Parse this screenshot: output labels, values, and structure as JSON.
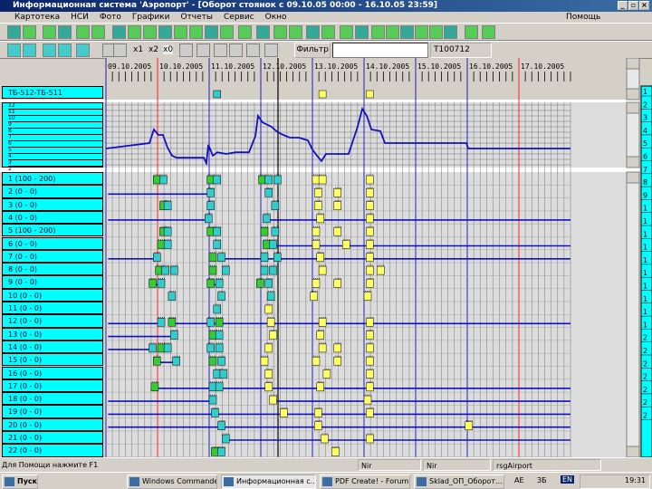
{
  "window": {
    "title": "Информационная система 'Аэропорт' - [Оборот стоянок с 09.10.05 00:00 - 16.10.05 23:59]"
  },
  "menu": {
    "items": [
      "Картотека",
      "НСИ",
      "Фото",
      "Графики",
      "Отчеты",
      "Сервис",
      "Окно"
    ],
    "help": "Помощь"
  },
  "toolbar2": {
    "zoom_x1": "x1",
    "zoom_x2": "x2",
    "zoom_x0": "x0",
    "filter_label": "Фильтр",
    "filter_value": "",
    "code_value": "T100712"
  },
  "timeline": {
    "dates": [
      "09.10.2005",
      "10.10.2005",
      "11.10.2005",
      "12.10.2005",
      "13.10.2005",
      "14.10.2005",
      "15.10.2005",
      "16.10.2005",
      "17.10.2005"
    ],
    "header_label": "ТБ-512-ТБ-511"
  },
  "graph": {
    "y_labels": [
      "12",
      "11",
      "10",
      "9",
      "8",
      "7",
      "6",
      "5",
      "4",
      "3",
      "2",
      "1"
    ],
    "series_hours": [
      0,
      20.2,
      22.3,
      24.4,
      26.5,
      28.6,
      30.7,
      32.8,
      45.5,
      46.7,
      47.6,
      49.7,
      51.8,
      56,
      60.2,
      66.5,
      69.5,
      70.7,
      72.8,
      77,
      79.2,
      81.3,
      85.5,
      89.7,
      93.9,
      96,
      98.1,
      100.2,
      102.3,
      112.8,
      117,
      119.2,
      121.3,
      123.4,
      127.6,
      129.7,
      167.6,
      168.4,
      216
    ],
    "series_levels": [
      3.5,
      4.5,
      7,
      6,
      6,
      3.7,
      2.2,
      1.8,
      1.8,
      0.8,
      4.2,
      2.2,
      2.8,
      2.5,
      2.8,
      2.8,
      5.8,
      9.5,
      8.3,
      7.5,
      6.7,
      6.2,
      5.5,
      5.5,
      5,
      3.3,
      2.2,
      1.2,
      2.5,
      2.5,
      7.5,
      10.8,
      9.5,
      7,
      6.7,
      4.5,
      4.5,
      3.5,
      3.5
    ]
  },
  "colors": {
    "cyan": "#00ffff",
    "green": "#33cc33",
    "marker_cyan": "#33cccc",
    "yellow": "#ffff66",
    "line": "#1010c0",
    "day": "#2020c0",
    "now": "#ff2020"
  },
  "rows": [
    {
      "label": "1 (100 - 200)",
      "lines": [],
      "m": [
        [
          22,
          "g"
        ],
        [
          25,
          "c"
        ],
        [
          47,
          "g"
        ],
        [
          50,
          "c"
        ],
        [
          71,
          "g"
        ],
        [
          74,
          "c"
        ],
        [
          78,
          "c"
        ],
        [
          96,
          "y"
        ],
        [
          99,
          "y"
        ],
        [
          121,
          "y"
        ]
      ]
    },
    {
      "label": "2 (0 - 0)",
      "lines": [
        [
          1,
          47
        ]
      ],
      "m": [
        [
          47,
          "c"
        ],
        [
          74,
          "c"
        ],
        [
          97,
          "y"
        ],
        [
          106,
          "y"
        ],
        [
          121,
          "y"
        ]
      ]
    },
    {
      "label": "3 (0 - 0)",
      "lines": [],
      "m": [
        [
          25,
          "g"
        ],
        [
          27,
          "c"
        ],
        [
          47,
          "c"
        ],
        [
          77,
          "c"
        ],
        [
          97,
          "y"
        ],
        [
          106,
          "y"
        ],
        [
          121,
          "y"
        ]
      ]
    },
    {
      "label": "4 (0 - 0)",
      "lines": [
        [
          1,
          46
        ],
        [
          75,
          216
        ]
      ],
      "m": [
        [
          46,
          "c"
        ],
        [
          73,
          "c"
        ],
        [
          98,
          "y"
        ],
        [
          121,
          "y"
        ]
      ]
    },
    {
      "label": "5 (100 - 200)",
      "lines": [],
      "m": [
        [
          25,
          "g"
        ],
        [
          27,
          "c"
        ],
        [
          47,
          "g"
        ],
        [
          50,
          "c"
        ],
        [
          72,
          "g"
        ],
        [
          77,
          "c"
        ],
        [
          96,
          "y"
        ],
        [
          106,
          "y"
        ],
        [
          121,
          "y"
        ]
      ]
    },
    {
      "label": "6 (0 - 0)",
      "lines": [
        [
          74,
          216
        ]
      ],
      "m": [
        [
          24,
          "g"
        ],
        [
          27,
          "c"
        ],
        [
          50,
          "c"
        ],
        [
          73,
          "g"
        ],
        [
          76,
          "c"
        ],
        [
          96,
          "y"
        ],
        [
          110,
          "y"
        ],
        [
          121,
          "y"
        ]
      ]
    },
    {
      "label": "7 (0 - 0)",
      "lines": [
        [
          1,
          22
        ],
        [
          52,
          216
        ]
      ],
      "m": [
        [
          22,
          "c"
        ],
        [
          48,
          "g"
        ],
        [
          52,
          "c"
        ],
        [
          72,
          "c"
        ],
        [
          78,
          "c"
        ],
        [
          98,
          "y"
        ],
        [
          121,
          "y"
        ]
      ]
    },
    {
      "label": "8 (0 - 0)",
      "lines": [],
      "m": [
        [
          23,
          "g"
        ],
        [
          26,
          "c"
        ],
        [
          30,
          "c"
        ],
        [
          48,
          "g"
        ],
        [
          54,
          "c"
        ],
        [
          72,
          "c"
        ],
        [
          76,
          "c"
        ],
        [
          99,
          "y"
        ],
        [
          121,
          "y"
        ],
        [
          126,
          "y"
        ]
      ]
    },
    {
      "label": "9 (0 - 0)",
      "lines": [
        [
          22,
          24
        ],
        [
          49,
          51
        ]
      ],
      "m": [
        [
          20,
          "g"
        ],
        [
          24,
          "c"
        ],
        [
          47,
          "g"
        ],
        [
          51,
          "c"
        ],
        [
          70,
          "g"
        ],
        [
          74,
          "c"
        ],
        [
          96,
          "y"
        ],
        [
          106,
          "y"
        ],
        [
          121,
          "y"
        ]
      ]
    },
    {
      "label": "10 (0 - 0)",
      "lines": [],
      "m": [
        [
          29,
          "c"
        ],
        [
          52,
          "c"
        ],
        [
          75,
          "c"
        ],
        [
          95,
          "y"
        ],
        [
          120,
          "y"
        ]
      ]
    },
    {
      "label": "11 (0 - 0)",
      "lines": [],
      "m": [
        [
          50,
          "c"
        ],
        [
          74,
          "y"
        ]
      ]
    },
    {
      "label": "12 (0 - 0)",
      "lines": [
        [
          1,
          25
        ],
        [
          29,
          216
        ]
      ],
      "m": [
        [
          24,
          "c"
        ],
        [
          29,
          "g"
        ],
        [
          47,
          "c"
        ],
        [
          51,
          "g"
        ],
        [
          75,
          "y"
        ],
        [
          99,
          "y"
        ],
        [
          121,
          "y"
        ]
      ]
    },
    {
      "label": "13 (0 - 0)",
      "lines": [
        [
          1,
          30
        ]
      ],
      "m": [
        [
          30,
          "c"
        ],
        [
          48,
          "g"
        ],
        [
          51,
          "c"
        ],
        [
          76,
          "y"
        ],
        [
          98,
          "y"
        ],
        [
          121,
          "y"
        ]
      ]
    },
    {
      "label": "14 (0 - 0)",
      "lines": [
        [
          1,
          20
        ]
      ],
      "m": [
        [
          20,
          "c"
        ],
        [
          24,
          "g"
        ],
        [
          27,
          "c"
        ],
        [
          47,
          "c"
        ],
        [
          51,
          "c"
        ],
        [
          74,
          "y"
        ],
        [
          99,
          "y"
        ],
        [
          106,
          "y"
        ],
        [
          121,
          "y"
        ]
      ]
    },
    {
      "label": "15 (0 - 0)",
      "lines": [
        [
          22,
          31
        ]
      ],
      "m": [
        [
          22,
          "g"
        ],
        [
          31,
          "c"
        ],
        [
          48,
          "g"
        ],
        [
          52,
          "c"
        ],
        [
          72,
          "y"
        ],
        [
          96,
          "y"
        ],
        [
          106,
          "y"
        ],
        [
          121,
          "y"
        ]
      ]
    },
    {
      "label": "16 (0 - 0)",
      "lines": [],
      "m": [
        [
          50,
          "c"
        ],
        [
          53,
          "c"
        ],
        [
          74,
          "y"
        ],
        [
          101,
          "y"
        ],
        [
          121,
          "y"
        ]
      ]
    },
    {
      "label": "17 (0 - 0)",
      "lines": [
        [
          21,
          216
        ]
      ],
      "m": [
        [
          21,
          "g"
        ],
        [
          48,
          "c"
        ],
        [
          51,
          "c"
        ],
        [
          74,
          "y"
        ],
        [
          98,
          "y"
        ],
        [
          121,
          "y"
        ]
      ]
    },
    {
      "label": "18 (0 - 0)",
      "lines": [
        [
          1,
          48
        ],
        [
          76,
          216
        ]
      ],
      "m": [
        [
          48,
          "c"
        ],
        [
          76,
          "y"
        ],
        [
          120,
          "y"
        ]
      ]
    },
    {
      "label": "19 (0 - 0)",
      "lines": [
        [
          1,
          216
        ]
      ],
      "m": [
        [
          49,
          "c"
        ],
        [
          81,
          "y"
        ],
        [
          97,
          "y"
        ],
        [
          121,
          "y"
        ]
      ]
    },
    {
      "label": "20 (0 - 0)",
      "lines": [
        [
          1,
          216
        ]
      ],
      "m": [
        [
          52,
          "c"
        ],
        [
          97,
          "y"
        ],
        [
          167,
          "y"
        ]
      ]
    },
    {
      "label": "21 (0 - 0)",
      "lines": [
        [
          54,
          216
        ]
      ],
      "m": [
        [
          54,
          "c"
        ],
        [
          100,
          "y"
        ],
        [
          121,
          "y"
        ]
      ]
    },
    {
      "label": "22 (0 - 0)",
      "lines": [],
      "m": [
        [
          49,
          "g"
        ],
        [
          52,
          "c"
        ],
        [
          105,
          "y"
        ]
      ]
    }
  ],
  "right_list": [
    "1",
    "2",
    "3",
    "4",
    "5",
    "6",
    "7",
    "8",
    "9",
    "1",
    "1",
    "1",
    "1",
    "1",
    "1",
    "1",
    "1",
    "1",
    "1",
    "2",
    "2",
    "2",
    "2",
    "2",
    "2",
    "2"
  ],
  "status": {
    "help": "Для Помощи нажмите F1",
    "p1": "Nir",
    "p2": "Nir",
    "p3": "rsgAirport"
  },
  "taskbar": {
    "start": "Пуск",
    "tasks": [
      "Windows Commander ...",
      "Информационная с...",
      "PDF Create! - Forum",
      "Sklad_ОП_Оборот..."
    ],
    "lang": "EN",
    "tray_a": "АЕ",
    "tray_b": "ЗБ",
    "clock": "19:31"
  }
}
